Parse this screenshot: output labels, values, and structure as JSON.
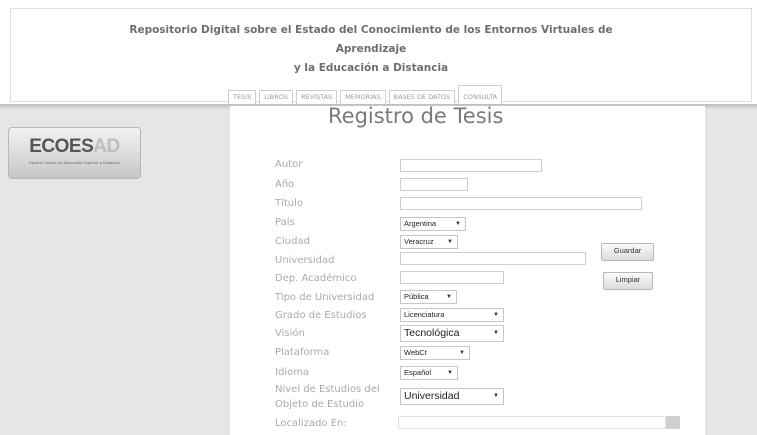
{
  "header": {
    "title_lines": [
      "Repositorio Digital sobre el Estado del Conocimiento de los Entornos Virtuales de",
      "Aprendizaje",
      "y la Educación a Distancia"
    ]
  },
  "tabs": [
    "TESIS",
    "LIBROS",
    "REVISTAS",
    "MEMORIAS",
    "BASES DE DATOS",
    "CONSULTA"
  ],
  "logo": {
    "main": "ECOES",
    "accent": "AD",
    "subtitle": "Espacio Común de Educación Superior a Distancia"
  },
  "page": {
    "title": "Registro de Tesis"
  },
  "form": {
    "labels": {
      "autor": "Autor",
      "anio": "Año",
      "titulo": "Título",
      "pais": "País",
      "ciudad": "Ciudad",
      "universidad": "Universidad",
      "dep": "Dep. Académico",
      "tipo": "Tipo de Universidad",
      "grado": "Grado de Estudios",
      "vision": "Visión",
      "plataforma": "Plataforma",
      "idioma": "Idioma",
      "nivel_1": "Nivel de Estudios del",
      "nivel_2": "Objeto de Estudio",
      "localizado": "Localizado En:"
    },
    "values": {
      "pais": "Argentina",
      "ciudad": "Veracruz",
      "tipo": "Pública",
      "grado": "Licenciatura",
      "vision": "Tecnológica",
      "plataforma": "WebCt",
      "idioma": "Español",
      "nivel": "Universidad"
    },
    "buttons": {
      "guardar": "Guardar",
      "limpiar": "Limpiar"
    }
  },
  "icons": {
    "dropdown": "chevron-down-icon"
  },
  "colors": {
    "background": "#ffffff",
    "band": "#e6e6e6",
    "label": "#aaaaaa"
  }
}
